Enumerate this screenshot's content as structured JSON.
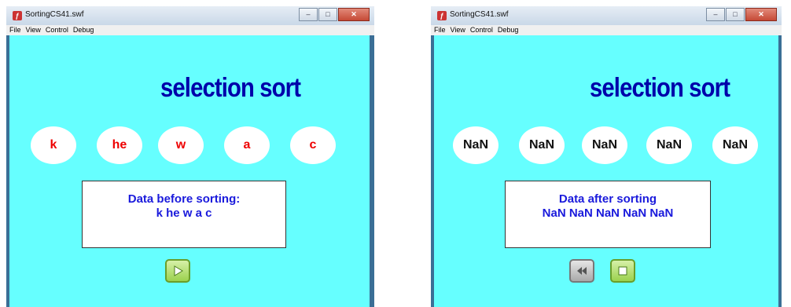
{
  "left_window": {
    "title": "SortingCS41.swf",
    "menu": [
      "File",
      "View",
      "Control",
      "Debug"
    ],
    "heading": "selection sort",
    "items": [
      "k",
      "he",
      "w",
      "a",
      "c"
    ],
    "info_line1": "Data before  sorting:",
    "info_line2": "k he w a c",
    "play_button_icon": "play-icon"
  },
  "right_window": {
    "title": "SortingCS41.swf",
    "menu": [
      "File",
      "View",
      "Control",
      "Debug"
    ],
    "heading": "selection sort",
    "items": [
      "NaN",
      "NaN",
      "NaN",
      "NaN",
      "NaN"
    ],
    "info_line1": "Data after sorting",
    "info_line2": "NaN NaN NaN NaN NaN",
    "rewind_button_icon": "rewind-icon",
    "stop_button_icon": "stop-icon"
  },
  "colors": {
    "stage_bg": "#66ffff",
    "heading": "#0000aa",
    "item_text_before": "#ee0000",
    "info_text": "#1a1adc"
  }
}
